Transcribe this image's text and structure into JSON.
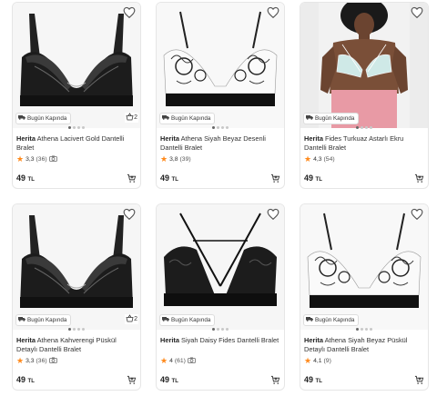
{
  "products": [
    {
      "brand": "Herita",
      "name": "Athena Lacivert Gold Dantelli Bralet",
      "rating": "3,3",
      "reviews": "(36)",
      "has_photo_icon": true,
      "price": "49",
      "currency": "TL",
      "badge": "Bugün Kapında",
      "basket_count": "2",
      "image": "black-lace"
    },
    {
      "brand": "Herita",
      "name": "Athena Siyah Beyaz Desenli Dantelli Bralet",
      "rating": "3,8",
      "reviews": "(39)",
      "has_photo_icon": false,
      "price": "49",
      "currency": "TL",
      "badge": "Bugün Kapında",
      "basket_count": "",
      "image": "white-black-lace"
    },
    {
      "brand": "Herita",
      "name": "Fides Turkuaz Astarlı Ekru Dantelli Bralet",
      "rating": "4,3",
      "reviews": "(54)",
      "has_photo_icon": false,
      "price": "49",
      "currency": "TL",
      "badge": "Bugün Kapında",
      "basket_count": "",
      "image": "model"
    },
    {
      "brand": "Herita",
      "name": "Athena Kahverengi Püskül Detaylı Dantelli Bralet",
      "rating": "3,3",
      "reviews": "(36)",
      "has_photo_icon": true,
      "price": "49",
      "currency": "TL",
      "badge": "Bugün Kapında",
      "basket_count": "2",
      "image": "black-lace"
    },
    {
      "brand": "Herita",
      "name": "Siyah Daisy Fides Dantelli Bralet",
      "rating": "4",
      "reviews": "(61)",
      "has_photo_icon": true,
      "price": "49",
      "currency": "TL",
      "badge": "Bugün Kapında",
      "basket_count": "",
      "image": "strappy-black"
    },
    {
      "brand": "Herita",
      "name": "Athena Siyah Beyaz Püskül Detaylı Dantelli Bralet",
      "rating": "4,1",
      "reviews": "(9)",
      "has_photo_icon": false,
      "price": "49",
      "currency": "TL",
      "badge": "Bugün Kapında",
      "basket_count": "",
      "image": "white-black-lace"
    }
  ],
  "colors": {
    "star": "#ff8a1c",
    "badge_border": "#dddddd",
    "card_border": "#e6e6e6",
    "text": "#333333"
  },
  "icons": {
    "favorite": "heart-icon",
    "cart": "add-to-cart-icon",
    "review_photo": "camera-icon",
    "delivery": "truck-icon",
    "basket": "basket-icon"
  }
}
